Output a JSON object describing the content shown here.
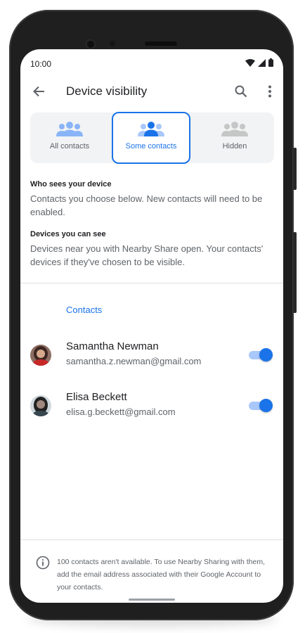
{
  "status_bar": {
    "time": "10:00"
  },
  "app_bar": {
    "title": "Device visibility"
  },
  "visibility_options": [
    {
      "label": "All contacts",
      "selected": false
    },
    {
      "label": "Some contacts",
      "selected": true
    },
    {
      "label": "Hidden",
      "selected": false
    }
  ],
  "who_sees": {
    "heading": "Who sees your device",
    "body": "Contacts you choose below. New contacts will need to be enabled."
  },
  "devices_see": {
    "heading": "Devices you can see",
    "body": "Devices near you with Nearby Share open. Your contacts' devices if they've chosen to be visible."
  },
  "contacts_section": {
    "heading": "Contacts",
    "items": [
      {
        "name": "Samantha Newman",
        "email": "samantha.z.newman@gmail.com",
        "enabled": true
      },
      {
        "name": "Elisa Beckett",
        "email": "elisa.g.beckett@gmail.com",
        "enabled": true
      }
    ]
  },
  "footer": {
    "text": "100 contacts aren't available. To use Nearby Sharing with them, add the email address associated with their Google Account to your contacts."
  },
  "colors": {
    "accent": "#1a73e8",
    "accent_light": "#8ab4f8",
    "inactive_icon": "#c4c7c5"
  }
}
